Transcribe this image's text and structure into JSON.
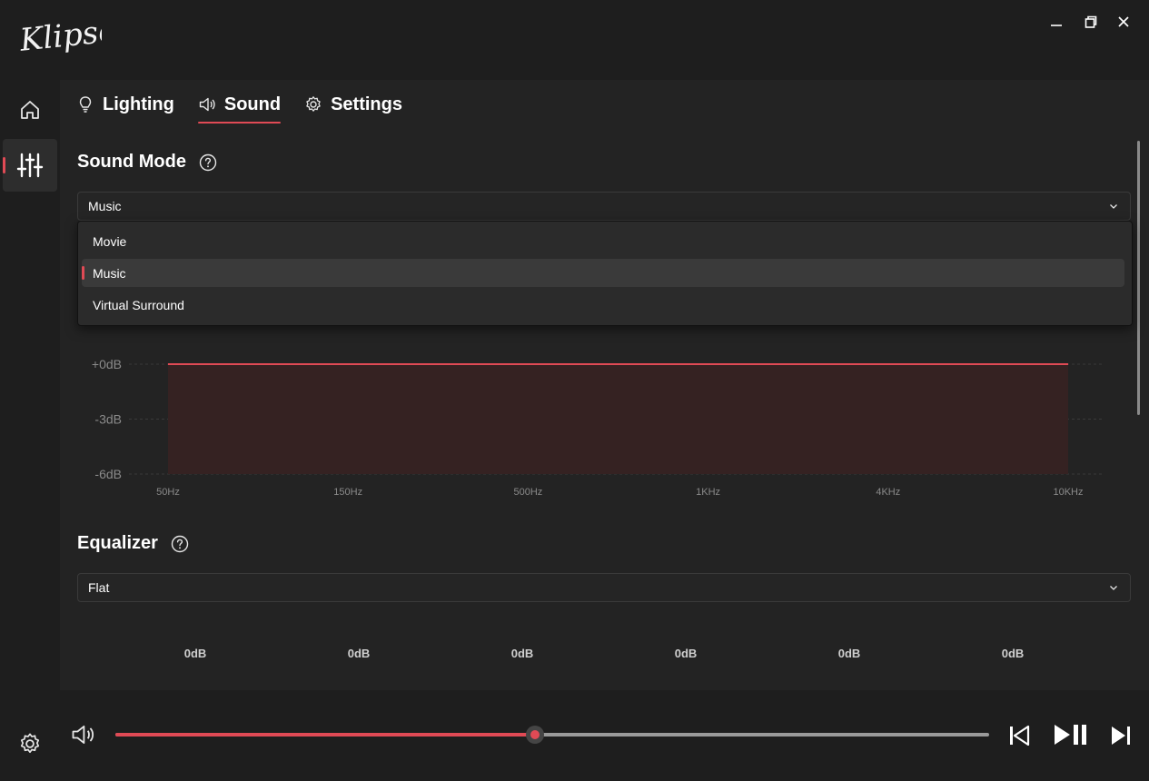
{
  "app": {
    "logo_text": "Klipsch"
  },
  "window_controls": [
    "minimize-icon",
    "restore-icon",
    "close-icon"
  ],
  "sidebar": {
    "items": [
      {
        "icon": "home-icon",
        "active": false
      },
      {
        "icon": "sliders-icon",
        "active": true
      }
    ],
    "bottom_icon": "gear-icon"
  },
  "tabs": [
    {
      "label": "Lighting",
      "icon": "bulb-icon",
      "active": false
    },
    {
      "label": "Sound",
      "icon": "speaker-icon",
      "active": true
    },
    {
      "label": "Settings",
      "icon": "gear-icon",
      "active": false
    }
  ],
  "sound_mode": {
    "title": "Sound Mode",
    "selected": "Music",
    "options": [
      "Movie",
      "Music",
      "Virtual Surround"
    ]
  },
  "chart_data": {
    "type": "area",
    "x": [
      "50Hz",
      "150Hz",
      "500Hz",
      "1KHz",
      "4KHz",
      "10KHz"
    ],
    "values": [
      0,
      0,
      0,
      0,
      0,
      0
    ],
    "yticks": [
      "+0dB",
      "-3dB",
      "-6dB"
    ],
    "ylim": [
      -6,
      0
    ],
    "grid": true,
    "color": "#e04a55"
  },
  "equalizer": {
    "title": "Equalizer",
    "selected": "Flat",
    "band_values": [
      "0dB",
      "0dB",
      "0dB",
      "0dB",
      "0dB",
      "0dB"
    ]
  },
  "player": {
    "volume_percent": 48,
    "accent": "#e04a55"
  }
}
